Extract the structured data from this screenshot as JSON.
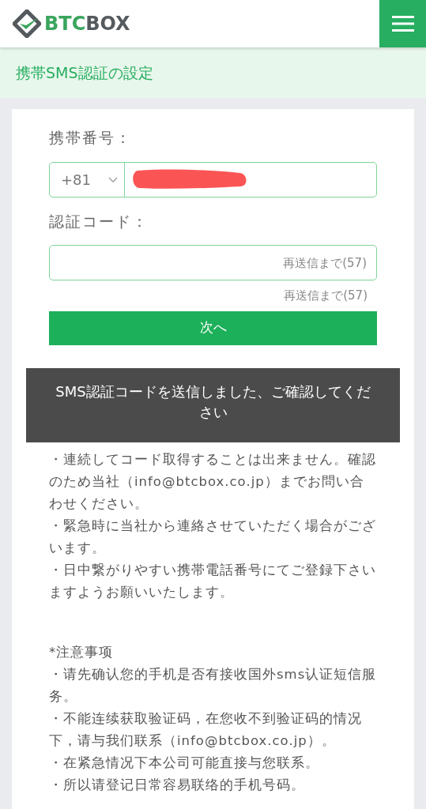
{
  "header": {
    "logo_text": [
      "BTC",
      "BOX"
    ]
  },
  "page_title": "携帯SMS認証の設定",
  "form": {
    "phone_label": "携帯番号：",
    "country_code": "+81",
    "phone_redacted": true,
    "code_label": "認証コード：",
    "code_placeholder": "再送信まで(57)",
    "resend_text": "再送信まで(57)",
    "next_button": "次へ"
  },
  "notes_ja": [
    "・連続してコード取得することは出来ません。確認のため当社（info@btcbox.co.jp）までお問い合わせください。",
    "・緊急時に当社から連絡させていただく場合がございます。",
    "・日中繋がりやすい携帯電話番号にてご登録下さいますようお願いいたします。"
  ],
  "notes_zh": [
    "*注意事项",
    "・请先确认您的手机是否有接收国外sms认证短信服务。",
    "・不能连续获取验证码，在您收不到验证码的情况下，请与我们联系（info@btcbox.co.jp）。",
    "・在紧急情况下本公司可能直接与您联系。",
    "・所以请登记日常容易联络的手机号码。"
  ],
  "toast": "SMS認証コードを送信しました、ご確認してください"
}
